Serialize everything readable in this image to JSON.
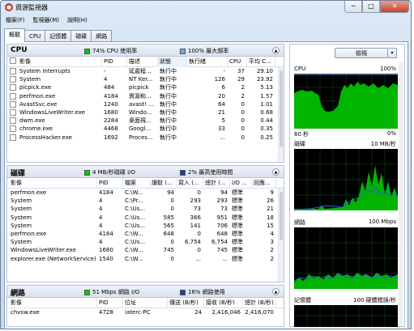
{
  "window": {
    "title": "資源監視器",
    "minimize": "─",
    "maximize": "□",
    "close": "✕"
  },
  "menu": [
    "檔案(F)",
    "監視器(M)",
    "說明(H)"
  ],
  "tabs": [
    "概觀",
    "CPU",
    "記憶體",
    "磁碟",
    "網路"
  ],
  "cpu": {
    "title": "CPU",
    "stat1": "74% CPU 使用率",
    "stat2": "100% 最大頻率",
    "c1": "#00cc00",
    "c2": "#6fa8dc",
    "headers": [
      "影像",
      "PID",
      "描述",
      "狀態",
      "執行緒",
      "CPU",
      "平均 C..."
    ],
    "rows": [
      [
        "System Interrupts",
        "-",
        "延遲程...",
        "執行中",
        "-",
        "37",
        "29.10"
      ],
      [
        "System",
        "4",
        "NT Ker...",
        "執行中",
        "126",
        "29",
        "23.92"
      ],
      [
        "picpick.exe",
        "484",
        "picpick",
        "執行中",
        "6",
        "2",
        "5.13"
      ],
      [
        "perfmon.exe",
        "4184",
        "資源和...",
        "執行中",
        "20",
        "2",
        "1.57"
      ],
      [
        "AvastSvc.exe",
        "1240",
        "avast! ...",
        "執行中",
        "64",
        "0",
        "1.01"
      ],
      [
        "WindowsLiveWriter.exe",
        "1680",
        "Windo...",
        "執行中",
        "21",
        "0",
        "0.68"
      ],
      [
        "dwm.exe",
        "2284",
        "桌面視...",
        "執行中",
        "5",
        "0",
        "0.44"
      ],
      [
        "chrome.exe",
        "4468",
        "Googl...",
        "執行中",
        "33",
        "0",
        "0.35"
      ],
      [
        "ProcessHacker.exe",
        "1692",
        "Proces...",
        "執行中",
        "...",
        "0",
        "0.25"
      ]
    ]
  },
  "disk": {
    "title": "磁碟",
    "stat1": "4 MB/秒磁碟 I/O",
    "stat2": "2% 最高使用時間",
    "c1": "#00cc00",
    "c2": "#1c3fa6",
    "headers": [
      "影像",
      "PID",
      "檔案",
      "讀取 (...",
      "寫入 (...",
      "總計 (...",
      "I/O ...",
      "回應..."
    ],
    "rows": [
      [
        "perfmon.exe",
        "4184",
        "C:\\W...",
        "94",
        "0",
        "94",
        "標準",
        "9"
      ],
      [
        "System",
        "4",
        "C:\\Pr...",
        "0",
        "293",
        "293",
        "標準",
        "26"
      ],
      [
        "System",
        "4",
        "C:\\Us...",
        "0",
        "73",
        "73",
        "標準",
        "21"
      ],
      [
        "System",
        "4",
        "C:\\Us...",
        "585",
        "366",
        "951",
        "標準",
        "18"
      ],
      [
        "System",
        "4",
        "C:\\Us...",
        "565",
        "141",
        "706",
        "標準",
        "15"
      ],
      [
        "perfmon.exe",
        "4184",
        "C:\\W...",
        "648",
        "0",
        "648",
        "標準",
        "4"
      ],
      [
        "System",
        "4",
        "C:\\Us...",
        "0",
        "6,754",
        "6,754",
        "標準",
        "3"
      ],
      [
        "WindowsLiveWriter.exe",
        "1680",
        "C:\\W...",
        "745",
        "0",
        "745",
        "標準",
        "2"
      ],
      [
        "explorer.exe (NetworkService)",
        "1540",
        "C:\\W...",
        "0",
        "...",
        "...",
        "標準",
        "2"
      ]
    ]
  },
  "net": {
    "title": "網路",
    "stat1": "51 Mbps 網路 I/O",
    "stat2": "16% 網路使用",
    "c1": "#00cc00",
    "c2": "#1c3fa6",
    "headers": [
      "影像",
      "PID",
      "位址",
      "傳送 (B/秒)",
      "接收 (B/秒)",
      "總計 (B/秒)"
    ],
    "rows": [
      [
        "chvsw.exe",
        "4728",
        "iaterc-PC",
        "24",
        "2,416,046",
        "2,416,070"
      ]
    ]
  },
  "right": {
    "view_label": "檢視",
    "dd": "▾",
    "graphs": [
      {
        "name": "CPU",
        "max": "100%",
        "min": "60 秒",
        "minr": "0%"
      },
      {
        "name": "磁碟",
        "max": "10 MB/秒"
      },
      {
        "name": "網路",
        "max": "100 Mbps"
      },
      {
        "name": "記憶體",
        "max": "100 硬體錯誤/秒"
      }
    ]
  }
}
